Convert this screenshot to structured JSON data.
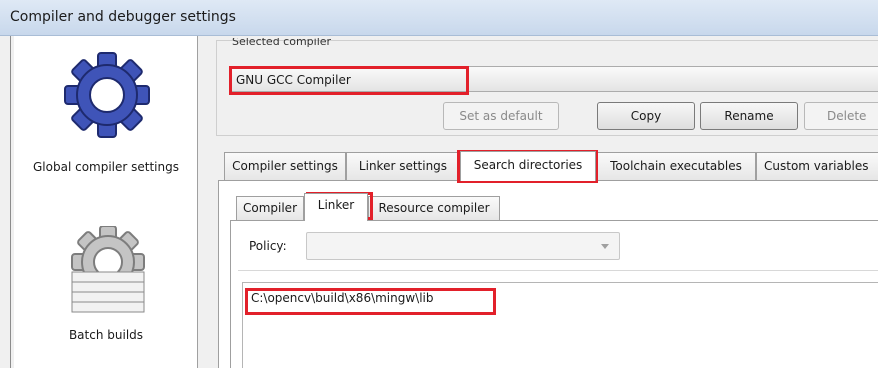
{
  "window": {
    "title": "Compiler and debugger settings"
  },
  "sidebar": {
    "items": [
      {
        "label": "Global compiler settings",
        "icon": "gear-icon"
      },
      {
        "label": "Batch builds",
        "icon": "batch-gear-icon"
      }
    ]
  },
  "selected_compiler": {
    "label": "Selected compiler",
    "value": "GNU GCC Compiler"
  },
  "buttons": {
    "set_default": "Set as default",
    "copy": "Copy",
    "rename": "Rename",
    "delete": "Delete"
  },
  "tabs": [
    {
      "label": "Compiler settings"
    },
    {
      "label": "Linker settings"
    },
    {
      "label": "Search directories",
      "active": true
    },
    {
      "label": "Toolchain executables"
    },
    {
      "label": "Custom variables"
    }
  ],
  "subtabs": [
    {
      "label": "Compiler"
    },
    {
      "label": "Linker",
      "active": true
    },
    {
      "label": "Resource compiler"
    }
  ],
  "policy": {
    "label": "Policy:",
    "value": ""
  },
  "directories": [
    "C:\\opencv\\build\\x86\\mingw\\lib"
  ],
  "colors": {
    "highlight": "#e2202a",
    "gear_blue": "#3f54b8",
    "gear_gray": "#b9b9b9"
  }
}
